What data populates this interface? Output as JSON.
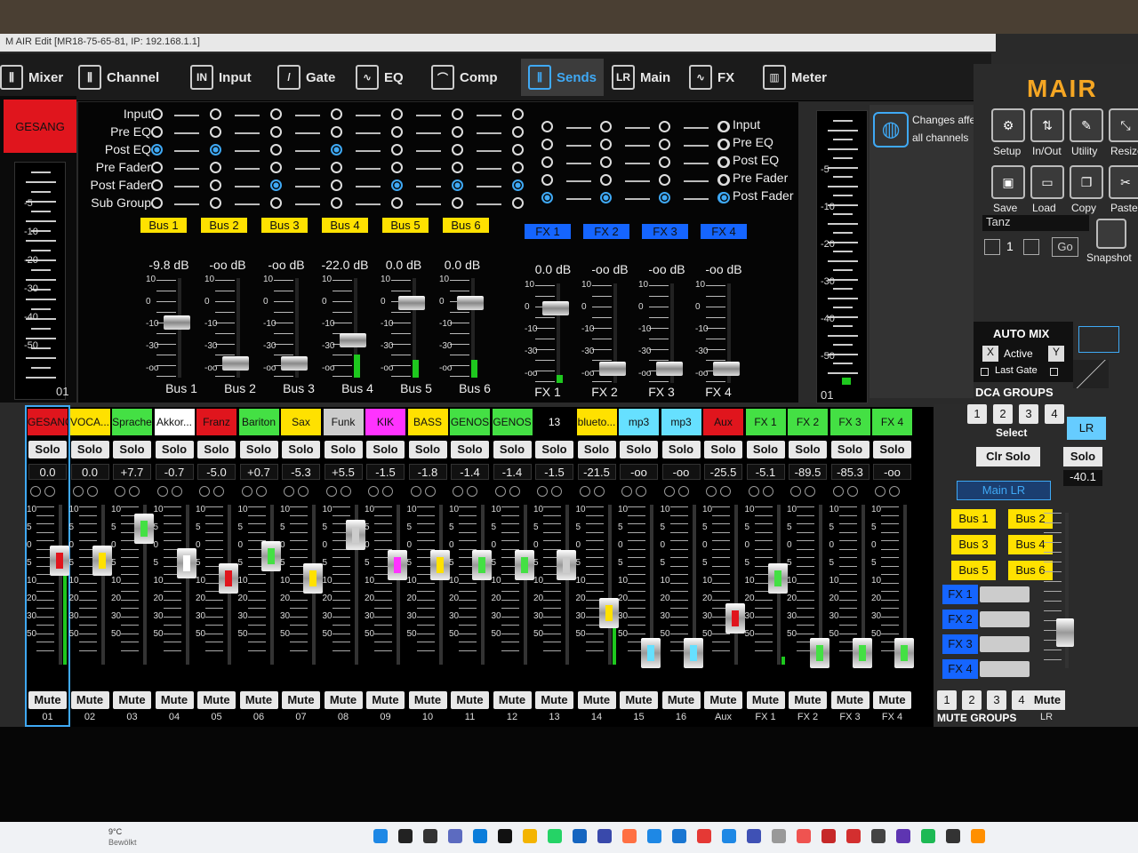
{
  "titlebar": "M AIR Edit [MR18-75-65-81, IP: 192.168.1.1]",
  "tabs": [
    {
      "label": "Mixer",
      "icon": "mixer-icon",
      "glyph": "⫼"
    },
    {
      "label": "Channel",
      "icon": "channel-icon",
      "glyph": "⫼"
    },
    {
      "label": "Input",
      "icon": "input-icon",
      "glyph": "IN"
    },
    {
      "label": "Gate",
      "icon": "gate-icon",
      "glyph": "/"
    },
    {
      "label": "EQ",
      "icon": "eq-icon",
      "glyph": "∿"
    },
    {
      "label": "Comp",
      "icon": "comp-icon",
      "glyph": "⌒"
    },
    {
      "label": "Sends",
      "icon": "sends-icon",
      "glyph": "⫼"
    },
    {
      "label": "Main",
      "icon": "main-icon",
      "glyph": "LR"
    },
    {
      "label": "FX",
      "icon": "fx-icon",
      "glyph": "∿"
    },
    {
      "label": "Meter",
      "icon": "meter-icon",
      "glyph": "▥"
    }
  ],
  "channel_label": "GESANG",
  "tap_points": [
    "Input",
    "Pre EQ",
    "Post EQ",
    "Pre Fader",
    "Post Fader",
    "Sub Group"
  ],
  "fx_tap_points": [
    "Input",
    "Pre EQ",
    "Post EQ",
    "Pre Fader",
    "Post Fader"
  ],
  "bus_sends": [
    {
      "tag": "Bus 1",
      "db": "-9.8 dB",
      "name": "Bus 1",
      "tap": 2,
      "level": 0,
      "pos": 0.42
    },
    {
      "tag": "Bus 2",
      "db": "-oo dB",
      "name": "Bus 2",
      "tap": 4,
      "level": 0,
      "pos": 0.88
    },
    {
      "tag": "Bus 3",
      "db": "-oo dB",
      "name": "Bus 3",
      "tap": 2,
      "level": 0,
      "pos": 0.88
    },
    {
      "tag": "Bus 4",
      "db": "-22.0 dB",
      "name": "Bus 4",
      "tap": 4,
      "level": 0.23,
      "pos": 0.62
    },
    {
      "tag": "Bus 5",
      "db": "0.0 dB",
      "name": "Bus 5",
      "tap": 4,
      "level": 0.18,
      "pos": 0.2
    },
    {
      "tag": "Bus 6",
      "db": "0.0 dB",
      "name": "Bus 6",
      "tap": 4,
      "level": 0.18,
      "pos": 0.2
    }
  ],
  "fx_sends": [
    {
      "tag": "FX 1",
      "db": "0.0 dB",
      "name": "FX 1",
      "tap": 4,
      "level": 0.08,
      "pos": 0.2
    },
    {
      "tag": "FX 2",
      "db": "-oo dB",
      "name": "FX 2",
      "tap": 4,
      "level": 0,
      "pos": 0.88
    },
    {
      "tag": "FX 3",
      "db": "-oo dB",
      "name": "FX 3",
      "tap": 4,
      "level": 0,
      "pos": 0.88
    },
    {
      "tag": "FX 4",
      "db": "-oo dB",
      "name": "FX 4",
      "tap": 4,
      "level": 0,
      "pos": 0.88
    }
  ],
  "mini_scale": [
    "10",
    "0",
    "-10",
    "-30",
    "-oo"
  ],
  "left_meter_scale": [
    "-5",
    "-10",
    "-20",
    "-30",
    "-40",
    "-50"
  ],
  "left_meter_label": "01",
  "right_meter_scale": [
    "-5",
    "-10",
    "-20",
    "-30",
    "-40",
    "-50"
  ],
  "right_meter_label": "01",
  "changes_note": {
    "line1": "Changes affect",
    "line2": "all channels"
  },
  "brand": "MAIR",
  "tools": [
    {
      "label": "Setup",
      "icon": "gear-icon",
      "glyph": "⚙"
    },
    {
      "label": "In/Out",
      "icon": "in-out-icon",
      "glyph": "⇅"
    },
    {
      "label": "Utility",
      "icon": "wrench-icon",
      "glyph": "✎"
    },
    {
      "label": "Resize",
      "icon": "resize-icon",
      "glyph": "⤡"
    },
    {
      "label": "Save",
      "icon": "save-icon",
      "glyph": "▣"
    },
    {
      "label": "Load",
      "icon": "folder-icon",
      "glyph": "▭"
    },
    {
      "label": "Copy",
      "icon": "copy-icon",
      "glyph": "❐"
    },
    {
      "label": "Paste",
      "icon": "paste-icon",
      "glyph": "✂"
    }
  ],
  "snapshot": {
    "name": "Tanz",
    "number": "1",
    "go": "Go",
    "label": "Snapshot"
  },
  "automix": {
    "title": "AUTO MIX",
    "x": "X",
    "active": "Active",
    "y": "Y",
    "last_gate": "Last Gate"
  },
  "dca": {
    "title": "DCA GROUPS",
    "buttons": [
      "1",
      "2",
      "3",
      "4"
    ],
    "select": "Select",
    "clr_solo": "Clr Solo"
  },
  "lr": {
    "label": "LR",
    "solo": "Solo",
    "value": "-40.1",
    "mute": "Mute",
    "num": "LR",
    "pos": 0.72
  },
  "main_lr": "Main LR",
  "sel_buses": [
    "Bus 1",
    "Bus 2",
    "Bus 3",
    "Bus 4",
    "Bus 5",
    "Bus 6"
  ],
  "sel_fx": [
    "FX 1",
    "FX 2",
    "FX 3",
    "FX 4"
  ],
  "mute_groups": {
    "title": "MUTE GROUPS",
    "buttons": [
      "1",
      "2",
      "3",
      "4"
    ]
  },
  "solo_label": "Solo",
  "mute_label": "Mute",
  "fader_scale": [
    "10",
    "5",
    "0",
    "5",
    "10",
    "20",
    "30",
    "50"
  ],
  "channels": [
    {
      "name": "GESANG",
      "color": "#e0151d",
      "val": "0.0",
      "num": "01",
      "pos": 0.27,
      "knob": "#e0151d",
      "meter": 0.6
    },
    {
      "name": "VOCA...",
      "color": "#ffe100",
      "val": "0.0",
      "num": "02",
      "pos": 0.27,
      "knob": "#ffe100",
      "meter": 0
    },
    {
      "name": "Sprache",
      "color": "#44e044",
      "val": "+7.7",
      "num": "03",
      "pos": 0.06,
      "knob": "#44e044",
      "meter": 0
    },
    {
      "name": "Akkor...",
      "color": "#ffffff",
      "val": "-0.7",
      "num": "04",
      "pos": 0.29,
      "knob": "#ffffff",
      "meter": 0
    },
    {
      "name": "Franz",
      "color": "#e0151d",
      "val": "-5.0",
      "num": "05",
      "pos": 0.39,
      "knob": "#e0151d",
      "meter": 0
    },
    {
      "name": "Bariton",
      "color": "#44e044",
      "val": "+0.7",
      "num": "06",
      "pos": 0.24,
      "knob": "#44e044",
      "meter": 0
    },
    {
      "name": "Sax",
      "color": "#ffe100",
      "val": "-5.3",
      "num": "07",
      "pos": 0.39,
      "knob": "#ffe100",
      "meter": 0
    },
    {
      "name": "Funk",
      "color": "#cccccc",
      "val": "+5.5",
      "num": "08",
      "pos": 0.1,
      "knob": "#cccccc",
      "meter": 0
    },
    {
      "name": "KIK",
      "color": "#ff33ff",
      "val": "-1.5",
      "num": "09",
      "pos": 0.3,
      "knob": "#ff33ff",
      "meter": 0
    },
    {
      "name": "BASS",
      "color": "#ffe100",
      "val": "-1.8",
      "num": "10",
      "pos": 0.3,
      "knob": "#ffe100",
      "meter": 0
    },
    {
      "name": "GENOS",
      "color": "#44e044",
      "val": "-1.4",
      "num": "11",
      "pos": 0.3,
      "knob": "#44e044",
      "meter": 0
    },
    {
      "name": "GENOS",
      "color": "#44e044",
      "val": "-1.4",
      "num": "12",
      "pos": 0.3,
      "knob": "#44e044",
      "meter": 0
    },
    {
      "name": "13",
      "color": "#000000",
      "val": "-1.5",
      "num": "13",
      "pos": 0.3,
      "knob": "#cccccc",
      "meter": 0
    },
    {
      "name": "blueto...",
      "color": "#ffe100",
      "val": "-21.5",
      "num": "14",
      "pos": 0.62,
      "knob": "#ffe100",
      "meter": 0.35
    },
    {
      "name": "mp3",
      "color": "#66e0ff",
      "val": "-oo",
      "num": "15",
      "pos": 0.88,
      "knob": "#66e0ff",
      "meter": 0
    },
    {
      "name": "mp3",
      "color": "#66e0ff",
      "val": "-oo",
      "num": "16",
      "pos": 0.88,
      "knob": "#66e0ff",
      "meter": 0
    },
    {
      "name": "Aux",
      "color": "#e0151d",
      "val": "-25.5",
      "num": "Aux",
      "pos": 0.65,
      "knob": "#e0151d",
      "meter": 0
    },
    {
      "name": "FX 1",
      "color": "#44e044",
      "val": "-5.1",
      "num": "FX 1",
      "pos": 0.39,
      "knob": "#44e044",
      "meter": 0.05
    },
    {
      "name": "FX 2",
      "color": "#44e044",
      "val": "-89.5",
      "num": "FX 2",
      "pos": 0.88,
      "knob": "#44e044",
      "meter": 0
    },
    {
      "name": "FX 3",
      "color": "#44e044",
      "val": "-85.3",
      "num": "FX 3",
      "pos": 0.88,
      "knob": "#44e044",
      "meter": 0
    },
    {
      "name": "FX 4",
      "color": "#44e044",
      "val": "-oo",
      "num": "FX 4",
      "pos": 0.88,
      "knob": "#44e044",
      "meter": 0
    }
  ],
  "taskbar": {
    "weather_temp": "9°C",
    "weather_text": "Bewölkt"
  }
}
